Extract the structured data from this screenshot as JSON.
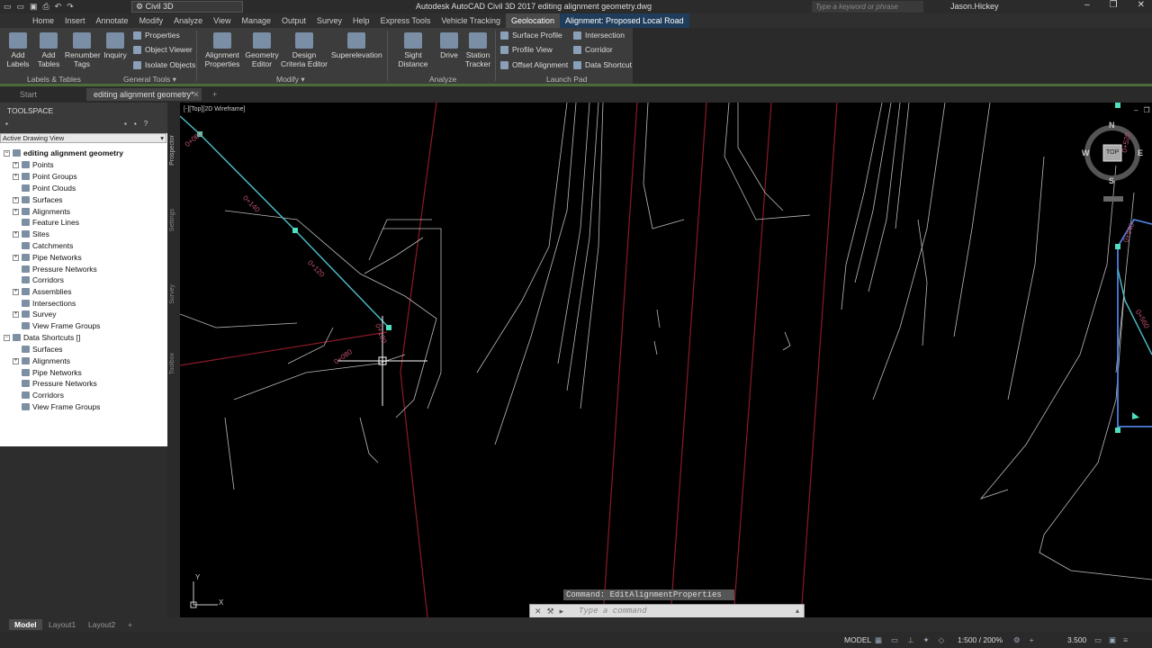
{
  "titlebar": {
    "workspace": "Civil 3D",
    "app_title": "Autodesk AutoCAD Civil 3D 2017    editing alignment geometry.dwg",
    "search_placeholder": "Type a keyword or phrase",
    "user": "Jason.Hickey"
  },
  "tabs": [
    "Home",
    "Insert",
    "Annotate",
    "Modify",
    "Analyze",
    "View",
    "Manage",
    "Output",
    "Survey",
    "Help",
    "Express Tools",
    "Vehicle Tracking",
    "Geolocation",
    "Alignment: Proposed Local Road"
  ],
  "ribbon": {
    "add_labels": "Add\nLabels",
    "add_tables": "Add\nTables",
    "renumber_tags": "Renumber\nTags",
    "inquiry": "Inquiry",
    "properties": "Properties",
    "object_viewer": "Object Viewer",
    "isolate_objects": "Isolate Objects",
    "alignment_properties": "Alignment\nProperties",
    "geometry_editor": "Geometry\nEditor",
    "design_criteria_editor": "Design\nCriteria Editor",
    "superelevation": "Superelevation",
    "sight_distance": "Sight Distance",
    "drive": "Drive",
    "station_tracker": "Station\nTracker",
    "surface_profile": "Surface Profile",
    "profile_view": "Profile View",
    "offset_alignment": "Offset Alignment",
    "intersection": "Intersection",
    "corridor": "Corridor",
    "data_shortcut": "Data Shortcut",
    "panels": {
      "labels_tables": "Labels & Tables",
      "general_tools": "General Tools",
      "modify": "Modify",
      "analyze": "Analyze",
      "launch_pad": "Launch Pad"
    }
  },
  "file_tabs": [
    "Start",
    "editing alignment geometry*"
  ],
  "toolspace": {
    "title": "TOOLSPACE",
    "view": "Active Drawing View",
    "root": "editing alignment geometry",
    "items": [
      "Points",
      "Point Groups",
      "Point Clouds",
      "Surfaces",
      "Alignments",
      "Feature Lines",
      "Sites",
      "Catchments",
      "Pipe Networks",
      "Pressure Networks",
      "Corridors",
      "Assemblies",
      "Intersections",
      "Survey",
      "View Frame Groups"
    ],
    "shortcuts_root": "Data Shortcuts []",
    "shortcut_items": [
      "Surfaces",
      "Alignments",
      "Pipe Networks",
      "Pressure Networks",
      "Corridors",
      "View Frame Groups"
    ],
    "side_tabs": [
      "Prospector",
      "Settings",
      "Survey",
      "Toolbox"
    ]
  },
  "viewport": {
    "label": "[-][Top][2D Wireframe]",
    "compass": {
      "n": "N",
      "s": "S",
      "e": "E",
      "w": "W",
      "top": "TOP"
    },
    "stations": [
      "0+140",
      "0+120",
      "0+100",
      "0+080",
      "0+060",
      "0+540",
      "0+520",
      "0+560"
    ],
    "ucs_x": "X",
    "ucs_y": "Y"
  },
  "command": {
    "history": "Command: EditAlignmentProperties",
    "placeholder": "Type a command"
  },
  "layout_tabs": [
    "Model",
    "Layout1",
    "Layout2"
  ],
  "status": {
    "model": "MODEL",
    "scale": "1:500 / 200%",
    "value": "3.500"
  }
}
